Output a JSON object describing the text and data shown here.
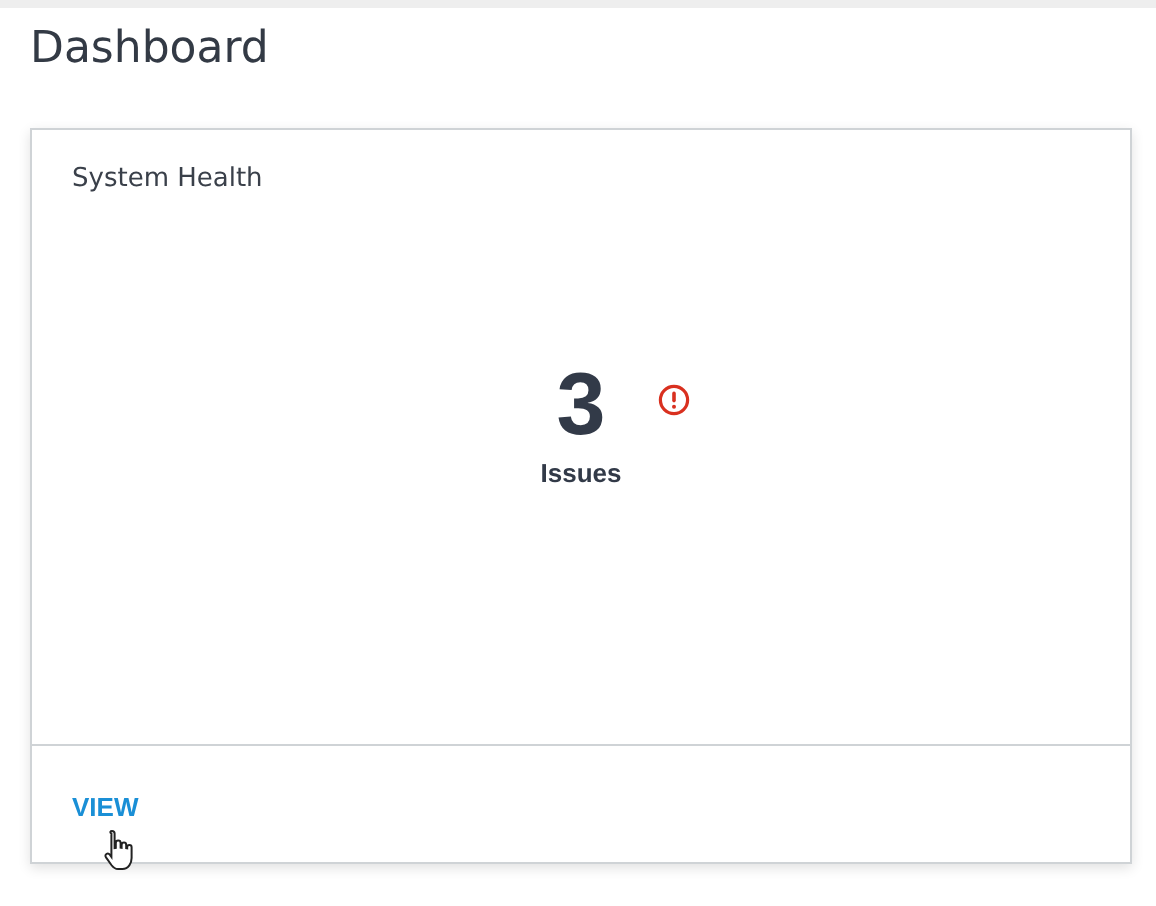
{
  "page": {
    "title": "Dashboard"
  },
  "card": {
    "title": "System Health",
    "count": "3",
    "count_label": "Issues",
    "alert": true,
    "action": "VIEW"
  }
}
